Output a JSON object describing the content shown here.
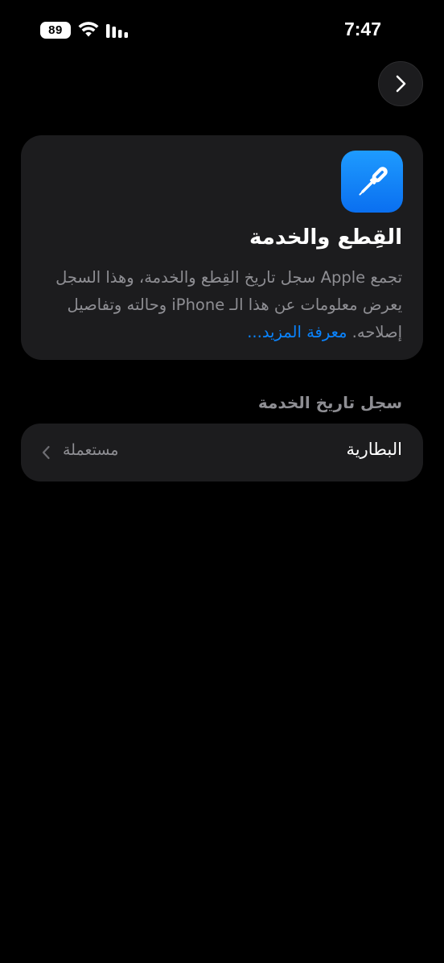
{
  "status_bar": {
    "battery_level": "89",
    "time": "7:47"
  },
  "nav": {
    "forward_icon": "chevron-right-icon"
  },
  "info_card": {
    "icon": "screwdriver-icon",
    "title": "القِطع والخدمة",
    "description": "تجمع Apple سجل تاريخ القِطع والخدمة، وهذا السجل يعرض معلومات عن هذا الـ iPhone وحالته وتفاصيل إصلاحه.",
    "learn_more": "معرفة المزيد..."
  },
  "service_history": {
    "header": "سجل تاريخ الخدمة",
    "items": [
      {
        "label": "البطارية",
        "value": "مستعملة"
      }
    ]
  },
  "colors": {
    "background": "#000000",
    "card": "#1c1c1e",
    "secondary_text": "#8e8e93",
    "link": "#0a84ff",
    "icon_blue": "#0a7cff"
  }
}
